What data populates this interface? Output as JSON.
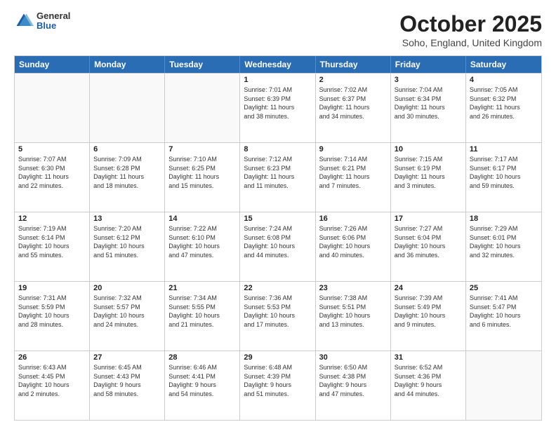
{
  "header": {
    "logo_general": "General",
    "logo_blue": "Blue",
    "month_title": "October 2025",
    "location": "Soho, England, United Kingdom"
  },
  "days_of_week": [
    "Sunday",
    "Monday",
    "Tuesday",
    "Wednesday",
    "Thursday",
    "Friday",
    "Saturday"
  ],
  "weeks": [
    [
      {
        "day": "",
        "info": ""
      },
      {
        "day": "",
        "info": ""
      },
      {
        "day": "",
        "info": ""
      },
      {
        "day": "1",
        "info": "Sunrise: 7:01 AM\nSunset: 6:39 PM\nDaylight: 11 hours\nand 38 minutes."
      },
      {
        "day": "2",
        "info": "Sunrise: 7:02 AM\nSunset: 6:37 PM\nDaylight: 11 hours\nand 34 minutes."
      },
      {
        "day": "3",
        "info": "Sunrise: 7:04 AM\nSunset: 6:34 PM\nDaylight: 11 hours\nand 30 minutes."
      },
      {
        "day": "4",
        "info": "Sunrise: 7:05 AM\nSunset: 6:32 PM\nDaylight: 11 hours\nand 26 minutes."
      }
    ],
    [
      {
        "day": "5",
        "info": "Sunrise: 7:07 AM\nSunset: 6:30 PM\nDaylight: 11 hours\nand 22 minutes."
      },
      {
        "day": "6",
        "info": "Sunrise: 7:09 AM\nSunset: 6:28 PM\nDaylight: 11 hours\nand 18 minutes."
      },
      {
        "day": "7",
        "info": "Sunrise: 7:10 AM\nSunset: 6:25 PM\nDaylight: 11 hours\nand 15 minutes."
      },
      {
        "day": "8",
        "info": "Sunrise: 7:12 AM\nSunset: 6:23 PM\nDaylight: 11 hours\nand 11 minutes."
      },
      {
        "day": "9",
        "info": "Sunrise: 7:14 AM\nSunset: 6:21 PM\nDaylight: 11 hours\nand 7 minutes."
      },
      {
        "day": "10",
        "info": "Sunrise: 7:15 AM\nSunset: 6:19 PM\nDaylight: 11 hours\nand 3 minutes."
      },
      {
        "day": "11",
        "info": "Sunrise: 7:17 AM\nSunset: 6:17 PM\nDaylight: 10 hours\nand 59 minutes."
      }
    ],
    [
      {
        "day": "12",
        "info": "Sunrise: 7:19 AM\nSunset: 6:14 PM\nDaylight: 10 hours\nand 55 minutes."
      },
      {
        "day": "13",
        "info": "Sunrise: 7:20 AM\nSunset: 6:12 PM\nDaylight: 10 hours\nand 51 minutes."
      },
      {
        "day": "14",
        "info": "Sunrise: 7:22 AM\nSunset: 6:10 PM\nDaylight: 10 hours\nand 47 minutes."
      },
      {
        "day": "15",
        "info": "Sunrise: 7:24 AM\nSunset: 6:08 PM\nDaylight: 10 hours\nand 44 minutes."
      },
      {
        "day": "16",
        "info": "Sunrise: 7:26 AM\nSunset: 6:06 PM\nDaylight: 10 hours\nand 40 minutes."
      },
      {
        "day": "17",
        "info": "Sunrise: 7:27 AM\nSunset: 6:04 PM\nDaylight: 10 hours\nand 36 minutes."
      },
      {
        "day": "18",
        "info": "Sunrise: 7:29 AM\nSunset: 6:01 PM\nDaylight: 10 hours\nand 32 minutes."
      }
    ],
    [
      {
        "day": "19",
        "info": "Sunrise: 7:31 AM\nSunset: 5:59 PM\nDaylight: 10 hours\nand 28 minutes."
      },
      {
        "day": "20",
        "info": "Sunrise: 7:32 AM\nSunset: 5:57 PM\nDaylight: 10 hours\nand 24 minutes."
      },
      {
        "day": "21",
        "info": "Sunrise: 7:34 AM\nSunset: 5:55 PM\nDaylight: 10 hours\nand 21 minutes."
      },
      {
        "day": "22",
        "info": "Sunrise: 7:36 AM\nSunset: 5:53 PM\nDaylight: 10 hours\nand 17 minutes."
      },
      {
        "day": "23",
        "info": "Sunrise: 7:38 AM\nSunset: 5:51 PM\nDaylight: 10 hours\nand 13 minutes."
      },
      {
        "day": "24",
        "info": "Sunrise: 7:39 AM\nSunset: 5:49 PM\nDaylight: 10 hours\nand 9 minutes."
      },
      {
        "day": "25",
        "info": "Sunrise: 7:41 AM\nSunset: 5:47 PM\nDaylight: 10 hours\nand 6 minutes."
      }
    ],
    [
      {
        "day": "26",
        "info": "Sunrise: 6:43 AM\nSunset: 4:45 PM\nDaylight: 10 hours\nand 2 minutes."
      },
      {
        "day": "27",
        "info": "Sunrise: 6:45 AM\nSunset: 4:43 PM\nDaylight: 9 hours\nand 58 minutes."
      },
      {
        "day": "28",
        "info": "Sunrise: 6:46 AM\nSunset: 4:41 PM\nDaylight: 9 hours\nand 54 minutes."
      },
      {
        "day": "29",
        "info": "Sunrise: 6:48 AM\nSunset: 4:39 PM\nDaylight: 9 hours\nand 51 minutes."
      },
      {
        "day": "30",
        "info": "Sunrise: 6:50 AM\nSunset: 4:38 PM\nDaylight: 9 hours\nand 47 minutes."
      },
      {
        "day": "31",
        "info": "Sunrise: 6:52 AM\nSunset: 4:36 PM\nDaylight: 9 hours\nand 44 minutes."
      },
      {
        "day": "",
        "info": ""
      }
    ]
  ]
}
